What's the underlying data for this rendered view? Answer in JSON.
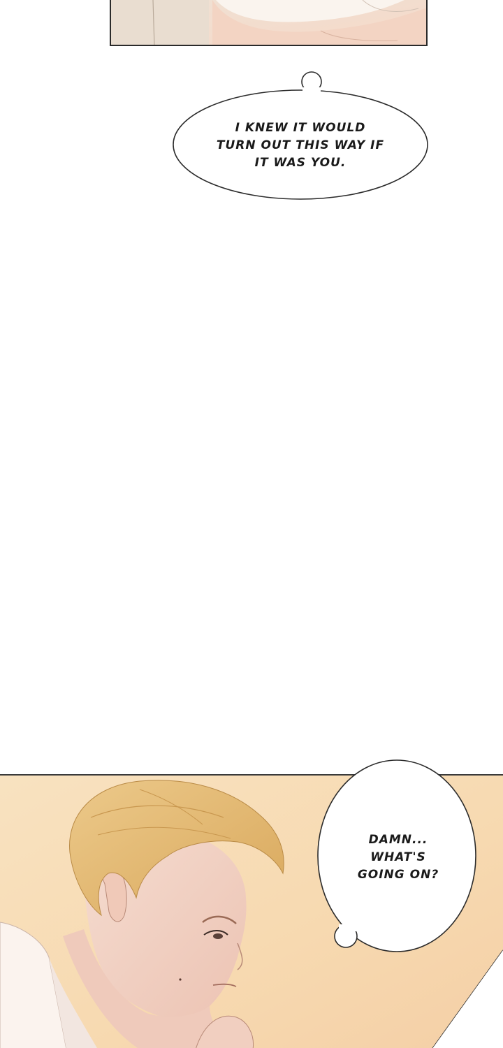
{
  "bubbles": [
    {
      "id": "bubble-1",
      "lines": [
        "I KNEW IT WOULD",
        "TURN OUT THIS WAY IF",
        "IT WAS YOU."
      ]
    },
    {
      "id": "bubble-2",
      "lines": [
        "DAMN...",
        "WHAT'S",
        "GOING ON?"
      ]
    }
  ],
  "colors": {
    "panel_border": "#2a2a2a",
    "skin": "#f0d2c4",
    "hair": "#e3b96a",
    "background_warm": "#f7dcb3",
    "bubble_fill": "#ffffff",
    "bubble_stroke": "#2b2b2b"
  }
}
